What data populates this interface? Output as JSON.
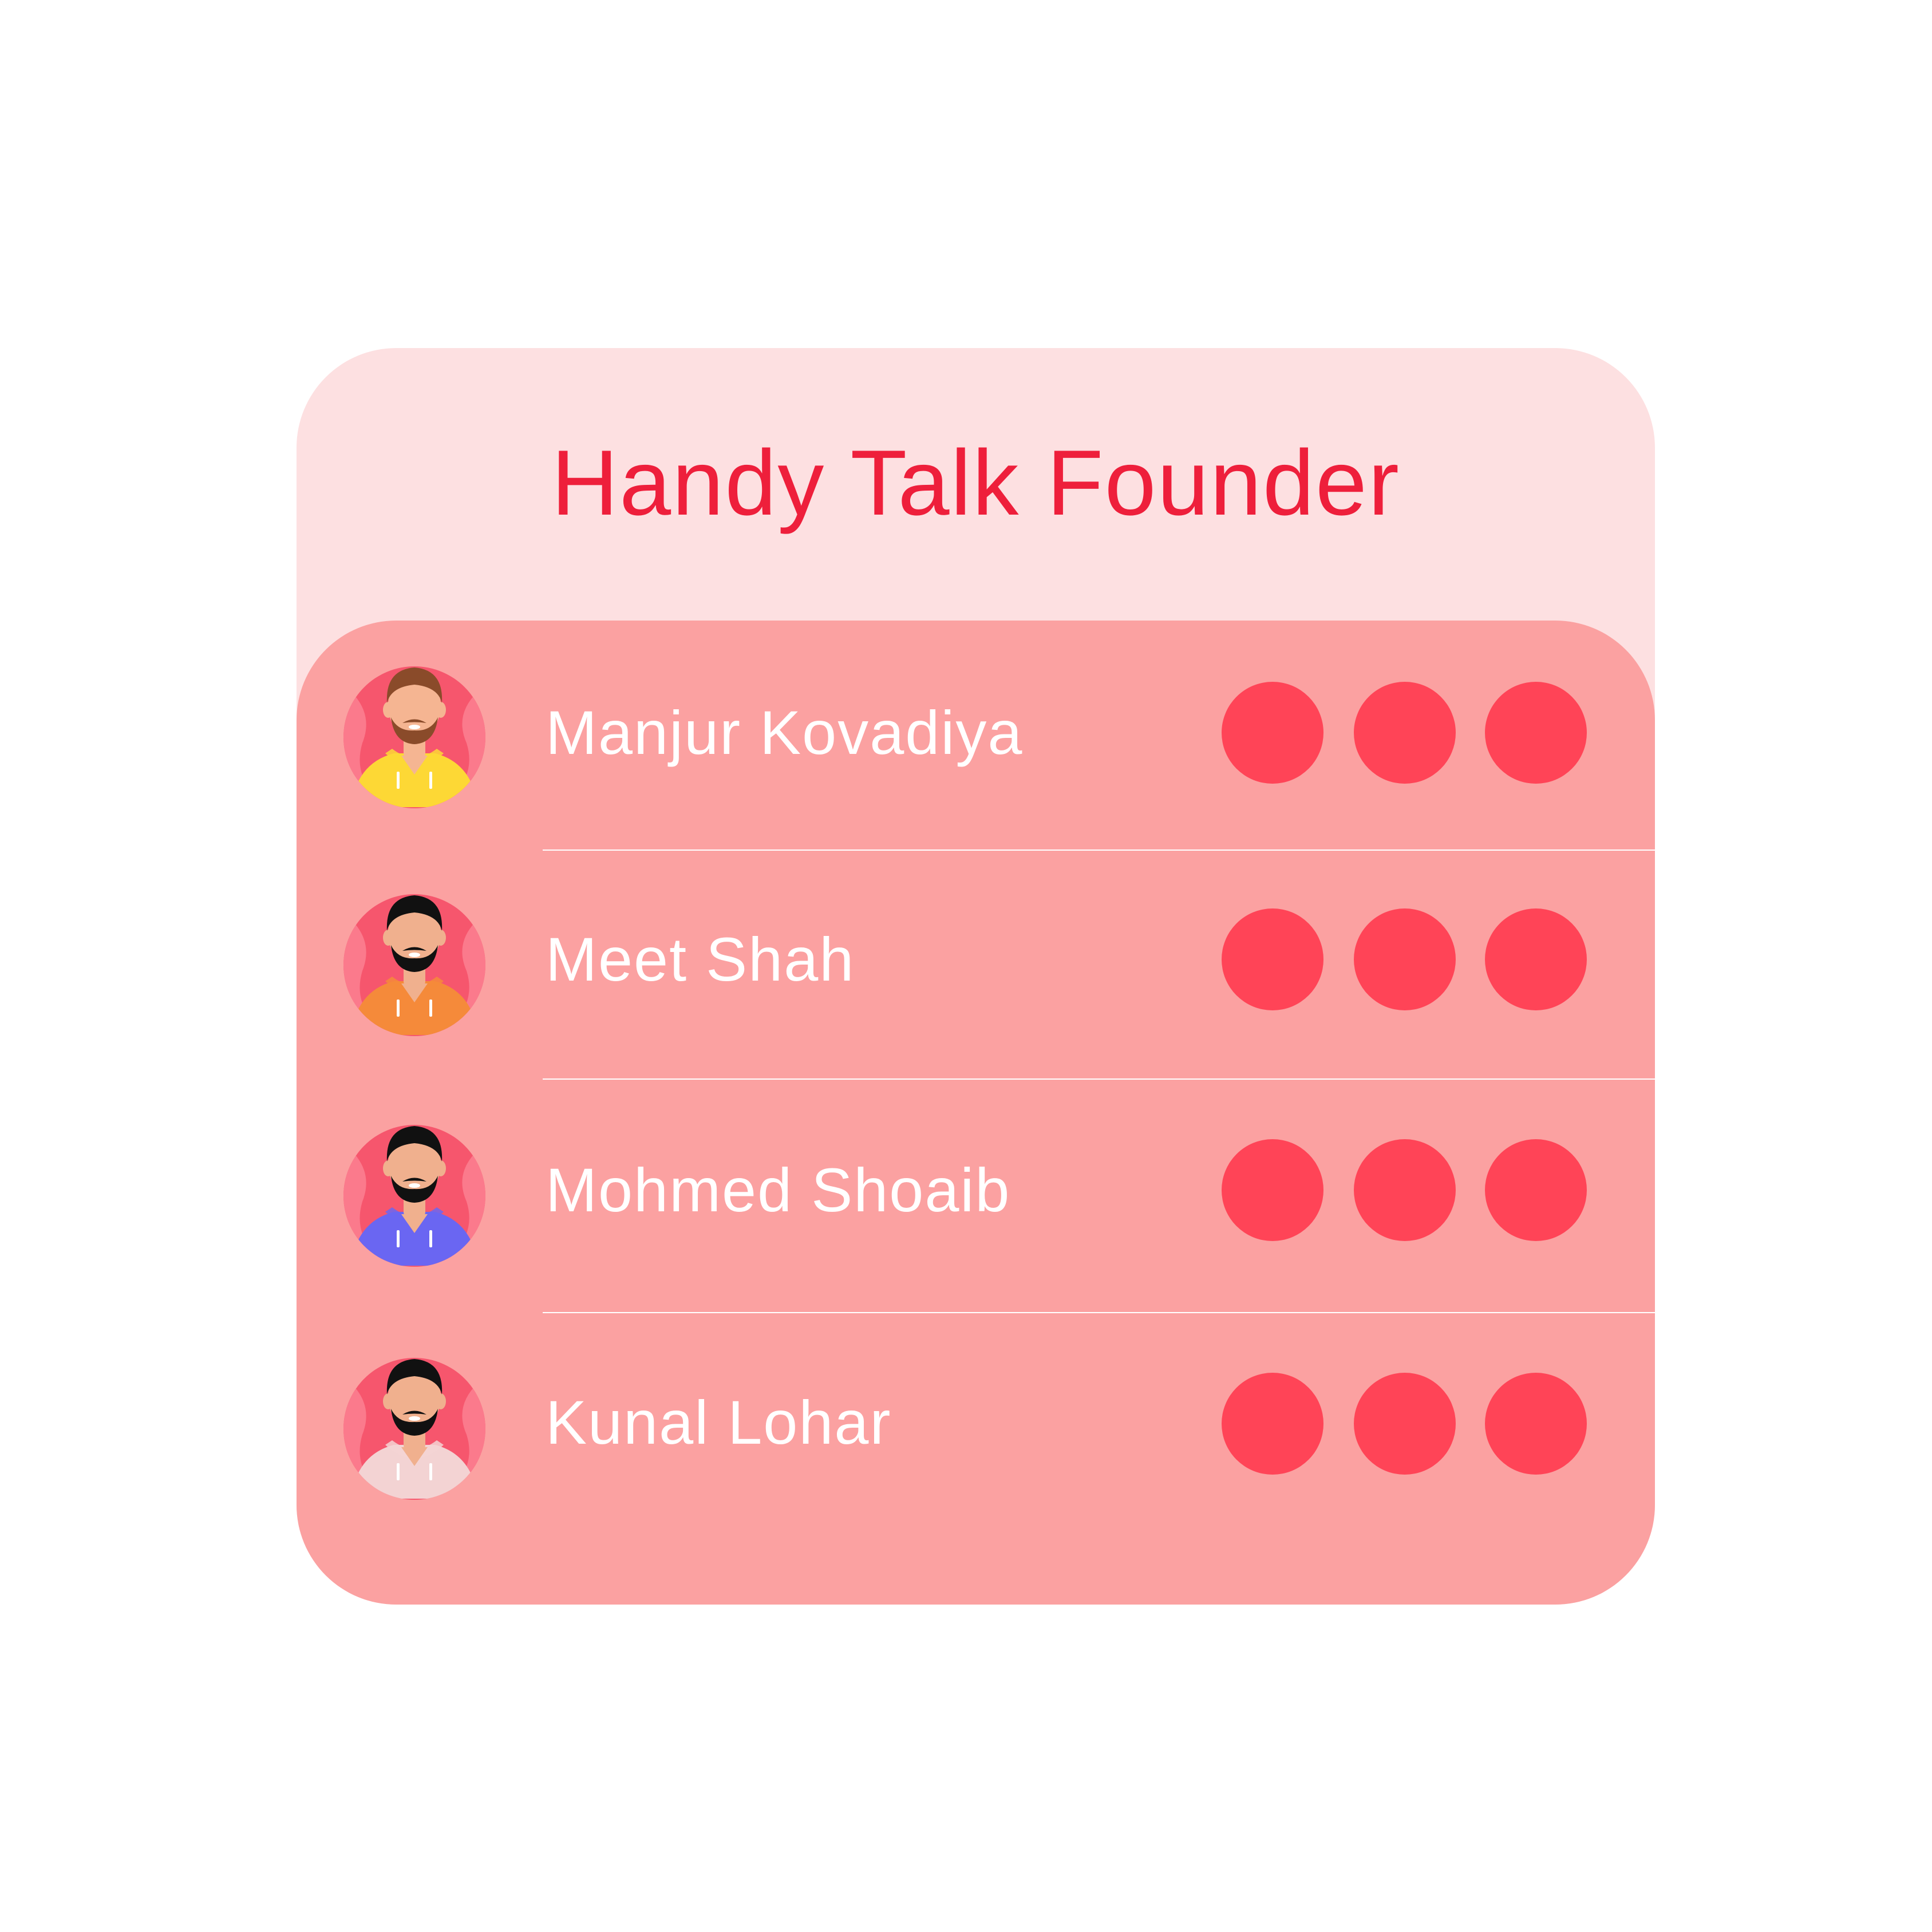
{
  "card": {
    "title": "Handy Talk Founder"
  },
  "colors": {
    "card_background": "#fde0e1",
    "list_background": "#fba1a1",
    "title": "#ee1f3b",
    "dot": "#ff4457",
    "name_text": "#ffffff"
  },
  "founders": [
    {
      "name": "Manjur Kovadiya",
      "avatar": "man-avatar-brown-hair-yellow-hoodie-icon",
      "hoodie_color": "#fdd835",
      "hair_color": "#8a4b2a",
      "skin_color": "#f5b592"
    },
    {
      "name": "Meet Shah",
      "avatar": "man-avatar-orange-hoodie-icon",
      "hoodie_color": "#f58a3a",
      "hair_color": "#111111",
      "skin_color": "#f0b08e"
    },
    {
      "name": "Mohmed Shoaib",
      "avatar": "man-avatar-blue-hoodie-icon",
      "hoodie_color": "#6a66f2",
      "hair_color": "#111111",
      "skin_color": "#f0b08e"
    },
    {
      "name": "Kunal Lohar",
      "avatar": "man-avatar-white-hoodie-icon",
      "hoodie_color": "#f3d3d3",
      "hair_color": "#111111",
      "skin_color": "#f0b08e"
    }
  ],
  "row_actions": [
    "status-dot",
    "status-dot",
    "status-dot"
  ]
}
